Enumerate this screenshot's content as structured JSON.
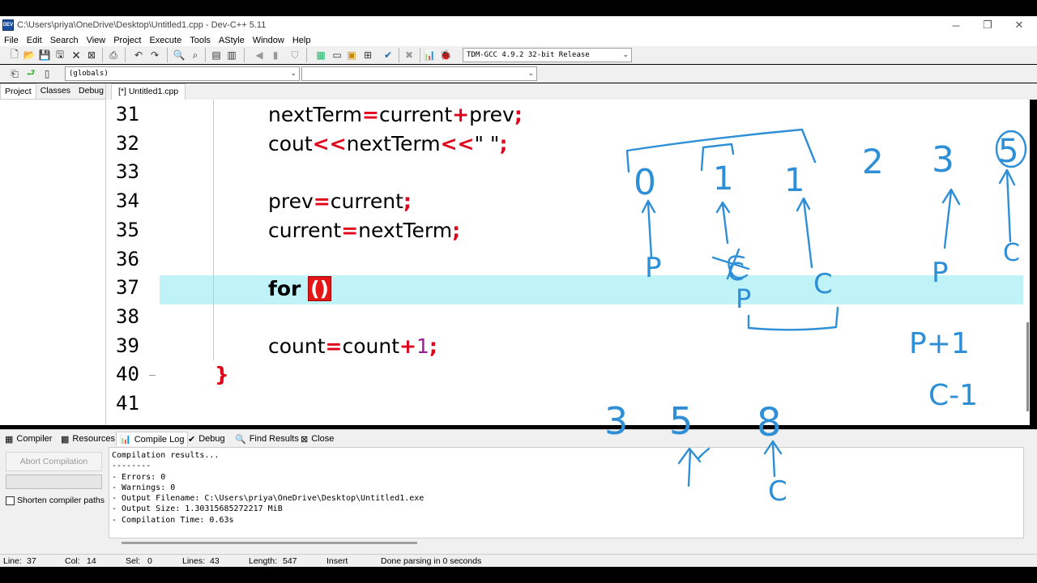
{
  "window": {
    "title": "C:\\Users\\priya\\OneDrive\\Desktop\\Untitled1.cpp - Dev-C++ 5.11",
    "icon_label": "DEV",
    "controls": [
      "─",
      "❐",
      "✕"
    ]
  },
  "menu": [
    "File",
    "Edit",
    "Search",
    "View",
    "Project",
    "Execute",
    "Tools",
    "AStyle",
    "Window",
    "Help"
  ],
  "toolbar": {
    "compiler_select": "TDM-GCC 4.9.2 32-bit Release",
    "globals_select": "(globals)",
    "members_select": ""
  },
  "left_panel": {
    "tabs": [
      "Project",
      "Classes",
      "Debug"
    ],
    "active_tab": "Project"
  },
  "editor": {
    "tab_label": "[*] Untitled1.cpp",
    "line_numbers": [
      "31",
      "32",
      "33",
      "34",
      "35",
      "36",
      "37",
      "38",
      "39",
      "40",
      "41"
    ],
    "current_line": 37,
    "lines": [
      {
        "parts": [
          {
            "t": "nextTerm",
            "c": ""
          },
          {
            "t": "=",
            "c": "op"
          },
          {
            "t": "current",
            "c": ""
          },
          {
            "t": "+",
            "c": "op"
          },
          {
            "t": "prev",
            "c": ""
          },
          {
            "t": ";",
            "c": "op"
          }
        ]
      },
      {
        "parts": [
          {
            "t": "cout",
            "c": ""
          },
          {
            "t": "<<",
            "c": "op"
          },
          {
            "t": "nextTerm",
            "c": ""
          },
          {
            "t": "<<",
            "c": "op"
          },
          {
            "t": "\" \"",
            "c": ""
          },
          {
            "t": ";",
            "c": "op"
          }
        ]
      },
      {
        "parts": []
      },
      {
        "parts": [
          {
            "t": "prev",
            "c": ""
          },
          {
            "t": "=",
            "c": "op"
          },
          {
            "t": "current",
            "c": ""
          },
          {
            "t": ";",
            "c": "op"
          }
        ]
      },
      {
        "parts": [
          {
            "t": "current",
            "c": ""
          },
          {
            "t": "=",
            "c": "op"
          },
          {
            "t": "nextTerm",
            "c": ""
          },
          {
            "t": ";",
            "c": "op"
          }
        ]
      },
      {
        "parts": []
      },
      {
        "parts": [
          {
            "t": "for ",
            "c": "kw"
          }
        ]
      },
      {
        "parts": []
      },
      {
        "parts": [
          {
            "t": "count",
            "c": ""
          },
          {
            "t": "=",
            "c": "op"
          },
          {
            "t": "count",
            "c": ""
          },
          {
            "t": "+",
            "c": "op"
          },
          {
            "t": "1",
            "c": "num"
          },
          {
            "t": ";",
            "c": "op"
          }
        ]
      },
      {
        "parts": [
          {
            "t": "}",
            "c": "brace"
          }
        ]
      },
      {
        "parts": []
      }
    ],
    "for_parens": "()"
  },
  "bottom_tabs": [
    "Compiler",
    "Resources",
    "Compile Log",
    "Debug",
    "Find Results",
    "Close"
  ],
  "bottom_active_tab": "Compile Log",
  "compile_panel": {
    "abort_label": "Abort Compilation",
    "shorten_label": "Shorten compiler paths",
    "log": "Compilation results...\n--------\n- Errors: 0\n- Warnings: 0\n- Output Filename: C:\\Users\\priya\\OneDrive\\Desktop\\Untitled1.exe\n- Output Size: 1.30315685272217 MiB\n- Compilation Time: 0.63s"
  },
  "status": {
    "line_label": "Line:",
    "line_value": "37",
    "col_label": "Col:",
    "col_value": "14",
    "sel_label": "Sel:",
    "sel_value": "0",
    "lines_label": "Lines:",
    "lines_value": "43",
    "length_label": "Length:",
    "length_value": "547",
    "mode": "Insert",
    "message": "Done parsing in 0 seconds"
  },
  "annotations": {
    "top_row": [
      "0",
      "1",
      "1",
      "2",
      "3",
      "5"
    ],
    "top_labels": [
      "P",
      "C",
      "P",
      "C"
    ],
    "crossed_label": "C",
    "new_p": "P",
    "formula_p": "P+1",
    "formula_c": "C-1",
    "bottom_row": [
      "3",
      "5",
      "8"
    ],
    "bottom_label": "C"
  },
  "colors": {
    "operator": "#e0001a",
    "number": "#9c1b96",
    "current_line_bg": "#bff3f7",
    "ink": "#2f8fd6"
  }
}
